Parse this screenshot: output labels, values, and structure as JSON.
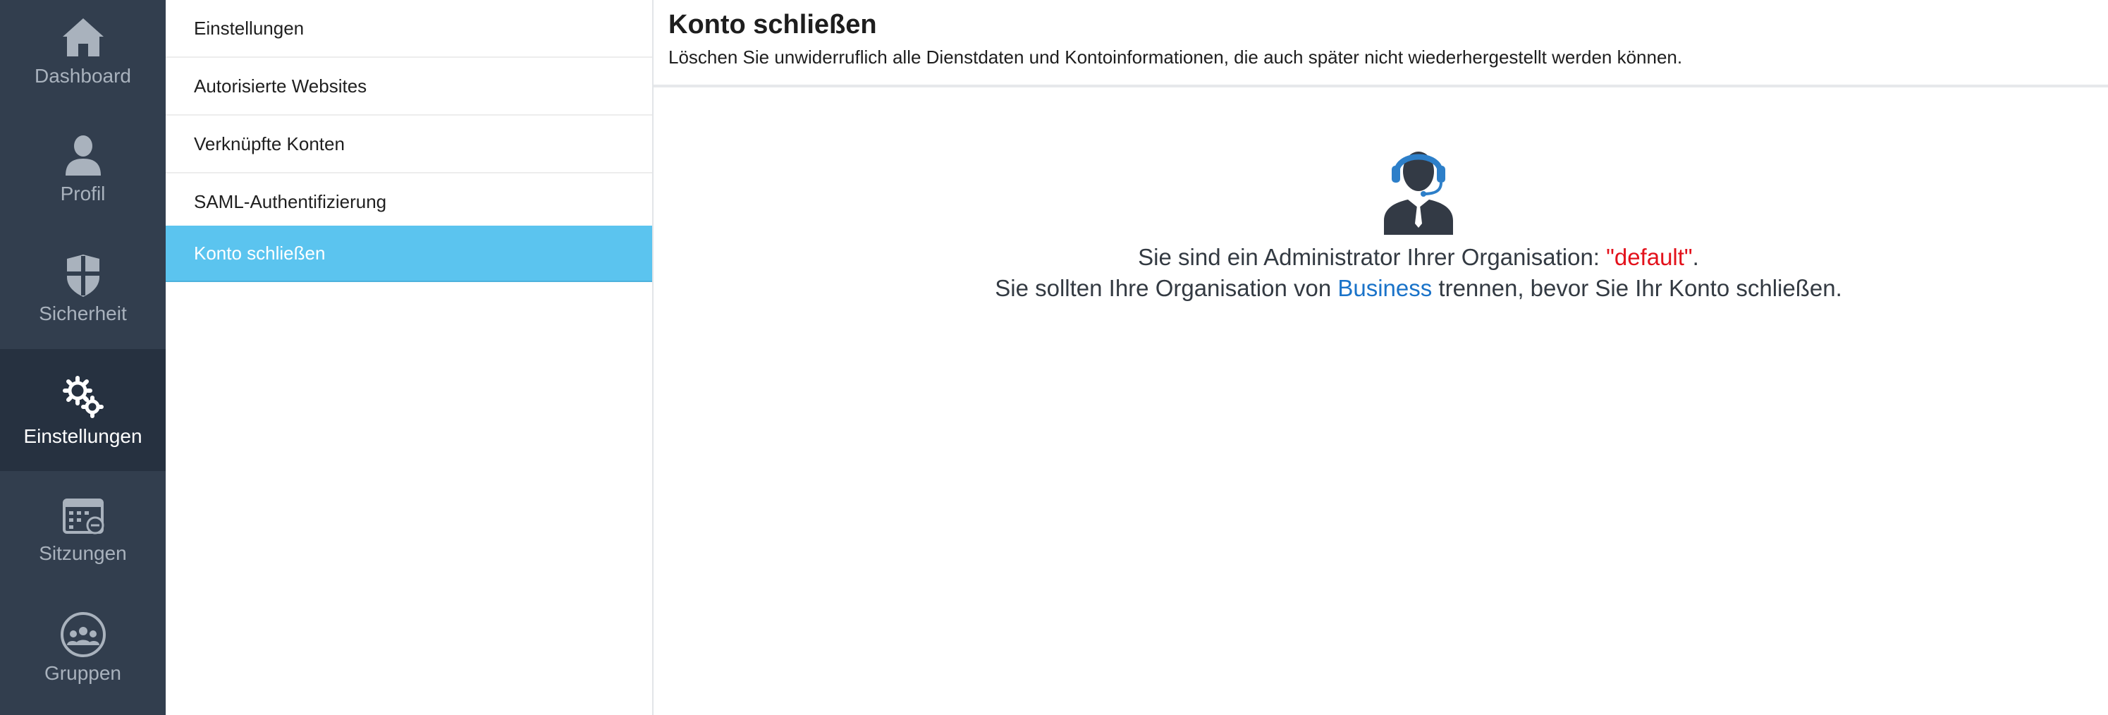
{
  "nav": {
    "items": [
      {
        "label": "Dashboard",
        "icon": "home-icon",
        "active": false
      },
      {
        "label": "Profil",
        "icon": "user-icon",
        "active": false
      },
      {
        "label": "Sicherheit",
        "icon": "shield-icon",
        "active": false
      },
      {
        "label": "Einstellungen",
        "icon": "gears-icon",
        "active": true
      },
      {
        "label": "Sitzungen",
        "icon": "calendar-icon",
        "active": false
      },
      {
        "label": "Gruppen",
        "icon": "group-icon",
        "active": false
      }
    ]
  },
  "submenu": {
    "items": [
      {
        "label": "Einstellungen",
        "active": false
      },
      {
        "label": "Autorisierte Websites",
        "active": false
      },
      {
        "label": "Verknüpfte Konten",
        "active": false
      },
      {
        "label": "SAML-Authentifizierung",
        "active": false
      },
      {
        "label": "Konto schließen",
        "active": true
      }
    ]
  },
  "page": {
    "title": "Konto schließen",
    "subtitle": "Löschen Sie unwiderruflich alle Dienstdaten und Kontoinformationen, die auch später nicht wiederhergestellt werden können."
  },
  "notice": {
    "icon": "admin-headset-icon",
    "line1_prefix": "Sie sind ein Administrator Ihrer Organisation: ",
    "org_name": "\"default\"",
    "line1_suffix": ".",
    "line2_prefix": "Sie sollten Ihre Organisation von ",
    "link_text": "Business",
    "line2_suffix": " trennen, bevor Sie Ihr Konto schließen."
  },
  "colors": {
    "nav_bg": "#323e4e",
    "nav_active_bg": "#263140",
    "submenu_active": "#5bc4ef",
    "org_name": "#e3111b",
    "link": "#1a73c9",
    "icon_blue": "#2d7fc9"
  }
}
